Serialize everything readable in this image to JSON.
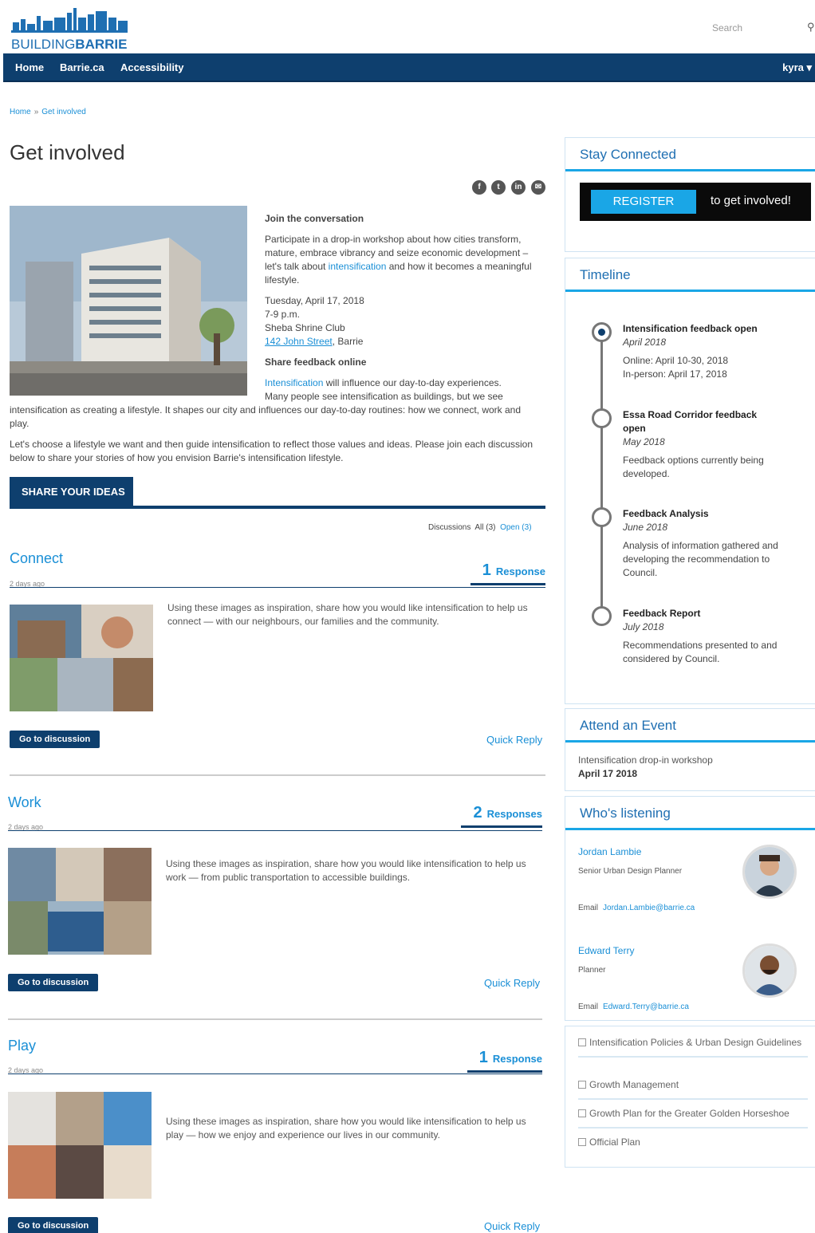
{
  "header": {
    "logo_text_plain": "BUILDING",
    "logo_text_bold": "BARRIE",
    "search_placeholder": "Search",
    "search_icon": "search-icon"
  },
  "nav": {
    "items": [
      "Home",
      "Barrie.ca",
      "Accessibility"
    ],
    "user": "kyra ▾"
  },
  "breadcrumb": {
    "home": "Home",
    "sep": "»",
    "current": "Get involved"
  },
  "page_title": "Get involved",
  "social_icons": [
    "facebook-icon",
    "twitter-icon",
    "linkedin-icon",
    "email-icon"
  ],
  "intro": {
    "heading": "Join the conversation",
    "p1_a": "Participate in a drop-in workshop about how cities transform, mature, embrace vibrancy and seize economic development – let's talk about ",
    "p1_link": "intensification",
    "p1_b": " and how it becomes a meaningful lifestyle.",
    "date": "Tuesday, April 17, 2018",
    "time": "7-9 p.m.",
    "venue": "Sheba Shrine Club",
    "address_link": "142 John Street",
    "address_city": ", Barrie",
    "heading2": "Share feedback online",
    "p2_link": "Intensification",
    "p2_a": " will influence our day-to-day experiences.",
    "p2_b": "Many people see intensification as buildings, but we see",
    "p2_full": "intensification as creating a lifestyle. It shapes our city and influences our day-to-day routines: how we connect, work and play.",
    "p3": "Let's choose a lifestyle we want and then guide intensification to reflect those values and ideas. Please join each discussion below to share your stories of how you envision Barrie's intensification lifestyle."
  },
  "share_tab": "SHARE YOUR IDEAS",
  "filter": {
    "label": "Discussions",
    "all": "All (3)",
    "open": "Open (3)"
  },
  "discussions": [
    {
      "title": "Connect",
      "time": "2 days ago",
      "count": "1",
      "resp_label": "Response",
      "text": "Using these images as inspiration, share how you would like intensification to help us connect — with our neighbours, our families and the community.",
      "button": "Go to discussion",
      "quick_reply": "Quick Reply"
    },
    {
      "title": "Work",
      "time": "2 days ago",
      "count": "2",
      "resp_label": "Responses",
      "text": "Using these images as inspiration, share how you would like intensification to help us work — from public transportation to accessible buildings.",
      "button": "Go to discussion",
      "quick_reply": "Quick Reply"
    },
    {
      "title": "Play",
      "time": "2 days ago",
      "count": "1",
      "resp_label": "Response",
      "text": "Using these images as inspiration, share how you would like intensification to help us play — how we enjoy and experience our lives in our community.",
      "button": "Go to discussion",
      "quick_reply": "Quick Reply"
    }
  ],
  "sidebar": {
    "stay_connected": {
      "title": "Stay Connected",
      "button": "REGISTER",
      "text": "to get involved!"
    },
    "timeline": {
      "title": "Timeline",
      "items": [
        {
          "title": "Intensification feedback open",
          "date": "April 2018",
          "desc1": "Online: April 10-30, 2018",
          "desc2": "In-person: April 17, 2018"
        },
        {
          "title": "Essa Road Corridor feedback open",
          "date": "May 2018",
          "desc1": "Feedback options currently being developed.",
          "desc2": ""
        },
        {
          "title": "Feedback Analysis",
          "date": "June 2018",
          "desc1": "Analysis of information gathered and developing the recommendation to Council.",
          "desc2": ""
        },
        {
          "title": "Feedback Report",
          "date": "July 2018",
          "desc1": "Recommendations presented to and considered by Council.",
          "desc2": ""
        }
      ]
    },
    "event": {
      "title": "Attend an Event",
      "name": "Intensification drop-in workshop",
      "date": "April 17 2018"
    },
    "listening": {
      "title": "Who's listening",
      "people": [
        {
          "name": "Jordan Lambie",
          "role": "Senior Urban Design Planner",
          "email_label": "Email",
          "email": "Jordan.Lambie@barrie.ca"
        },
        {
          "name": "Edward Terry",
          "role": "Planner",
          "email_label": "Email",
          "email": "Edward.Terry@barrie.ca"
        }
      ]
    },
    "links": [
      "Intensification Policies & Urban Design Guidelines",
      "Growth Management",
      "Growth Plan for the Greater Golden Horseshoe",
      "Official Plan"
    ]
  }
}
